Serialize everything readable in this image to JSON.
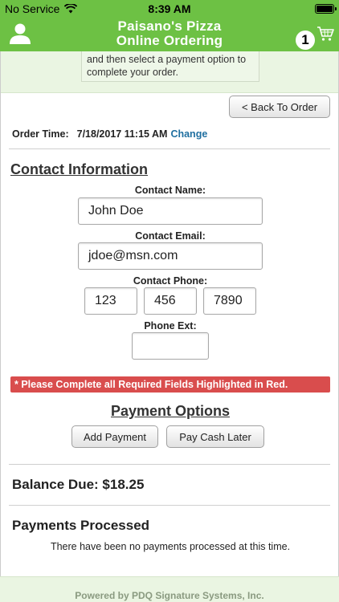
{
  "status_bar": {
    "carrier": "No Service",
    "time": "8:39 AM"
  },
  "nav": {
    "title_line1": "Paisano's Pizza",
    "title_line2": "Online Ordering",
    "cart_count": "1",
    "icons": {
      "user": "user-icon",
      "cart": "cart-icon",
      "wifi": "wifi-icon",
      "battery": "battery-icon"
    }
  },
  "notice": {
    "line1": "and then select a payment option to",
    "line2": "complete your order."
  },
  "back_button": "< Back To Order",
  "order_time": {
    "label": "Order Time:",
    "value": "7/18/2017 11:15 AM",
    "change_link": "Change"
  },
  "contact": {
    "title": "Contact Information",
    "name_label": "Contact Name:",
    "name_value": "John Doe",
    "email_label": "Contact Email:",
    "email_value": "jdoe@msn.com",
    "phone_label": "Contact Phone:",
    "phone_area": "123",
    "phone_prefix": "456",
    "phone_line": "7890",
    "ext_label": "Phone Ext:",
    "ext_value": ""
  },
  "alert": "* Please Complete all Required Fields Highlighted in Red.",
  "payment": {
    "title": "Payment Options",
    "add_payment": "Add Payment",
    "pay_cash_later": "Pay Cash Later"
  },
  "balance_due": "Balance Due: $18.25",
  "payments_processed": {
    "title": "Payments Processed",
    "message": "There have been no payments processed at this time."
  },
  "footer": "Powered by PDQ Signature Systems, Inc.",
  "colors": {
    "brand_green": "#6dc144",
    "alert_red": "#d94d4d",
    "link_blue": "#1f6fa0",
    "light_green": "#eaf5e2"
  }
}
